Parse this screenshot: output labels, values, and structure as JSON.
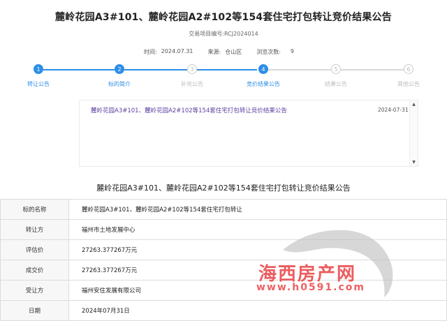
{
  "header": {
    "title": "麓岭花园A3#101、麓岭花园A2#102等154套住宅打包转让竞价结果公告",
    "project_code": "交易项目编号:RCJ2024014",
    "time_label": "时间:",
    "time_value": "2024.07.31",
    "source_label": "来源:",
    "source_value": "仓山区",
    "views_label": "浏览次数:",
    "views_value": "9"
  },
  "steps": [
    {
      "num": "1",
      "label": "转让公告",
      "state": "active"
    },
    {
      "num": "2",
      "label": "标的简介",
      "state": "active"
    },
    {
      "num": "3",
      "label": "补充公告",
      "state": "inactive"
    },
    {
      "num": "4",
      "label": "竞价结果公告",
      "state": "active"
    },
    {
      "num": "5",
      "label": "结果公告",
      "state": "inactive"
    },
    {
      "num": "6",
      "label": "其他公告",
      "state": "inactive"
    }
  ],
  "colors": {
    "accent": "#2d8ee6",
    "inactive": "#cccccc",
    "link": "#5b3fa0",
    "watermark": "#e9393d"
  },
  "notice_list": {
    "item_title": "麓岭花园A3#101、麓岭花园A2#102等154套住宅打包转让竞价结果公告",
    "item_date": "2024-07-31",
    "scroll_up_icon": "triangle-up-icon",
    "scroll_down_icon": "triangle-down-icon"
  },
  "section_title": "麓岭花园A3#101、麓岭花园A2#102等154套住宅打包转让竞价结果公告",
  "result_table": {
    "rows": [
      {
        "key": "标的名称",
        "value": "麓岭花园A3#101、麓岭花园A2#102等154套住宅打包转让"
      },
      {
        "key": "转让方",
        "value": "福州市土地发展中心"
      },
      {
        "key": "评估价",
        "value": "27263.377267万元"
      },
      {
        "key": "成交价",
        "value": "27263.377267万元"
      },
      {
        "key": "受让方",
        "value": "福州安住发展有限公司"
      },
      {
        "key": "日期",
        "value": "2024年07月31日"
      }
    ]
  },
  "watermark": {
    "brand": "海西房产网",
    "url": "www.h0591.com"
  }
}
